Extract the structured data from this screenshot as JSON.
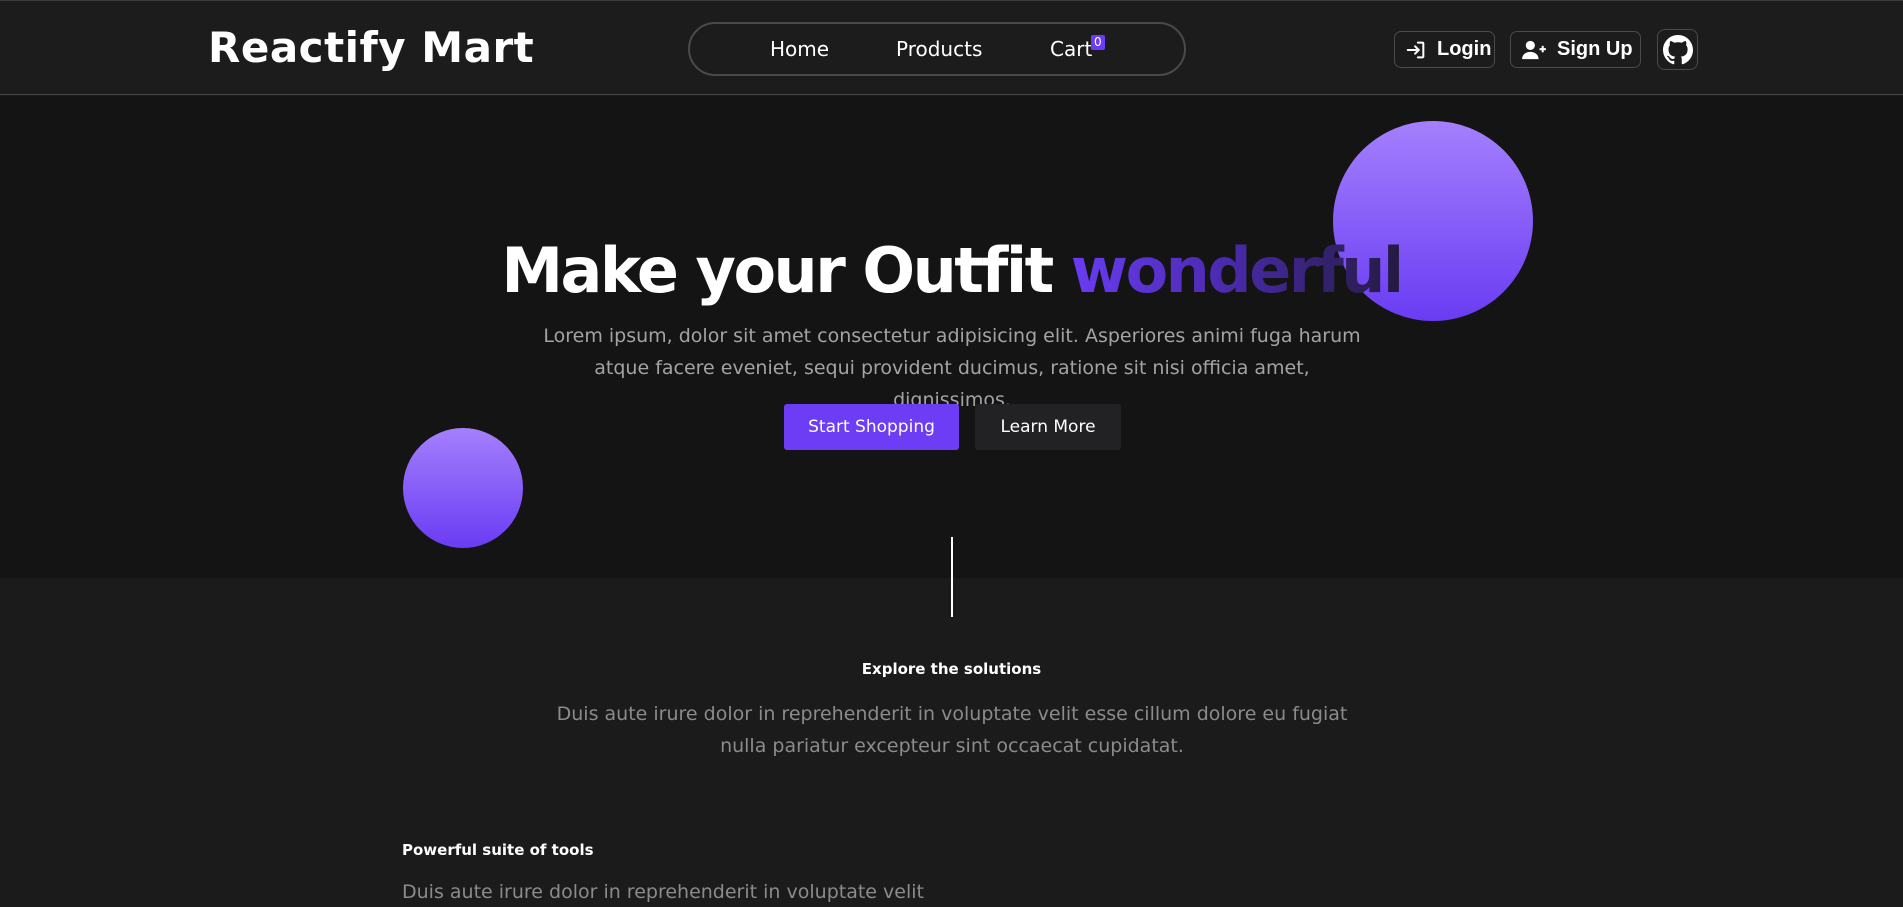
{
  "navbar": {
    "brand": "Reactify Mart",
    "links": [
      {
        "label": "Home"
      },
      {
        "label": "Products"
      },
      {
        "label": "Cart"
      }
    ],
    "cart_count": "0",
    "login_label": "Login",
    "signup_label": "Sign Up",
    "icons": {
      "login": "login-icon",
      "signup": "user-plus-icon",
      "github": "github-icon"
    }
  },
  "hero": {
    "title_main": "Make your Outfit ",
    "title_accent": "wonderful",
    "description": "Lorem ipsum, dolor sit amet consectetur adipisicing elit. Asperiores animi fuga harum atque facere eveniet, sequi provident ducimus, ratione sit nisi officia amet, dignissimos.",
    "primary_button": "Start Shopping",
    "secondary_button": "Learn More"
  },
  "solutions": {
    "heading": "Explore the solutions",
    "description": "Duis aute irure dolor in reprehenderit in voluptate velit esse cillum dolore eu fugiat nulla pariatur excepteur sint occaecat cupidatat."
  },
  "tools": {
    "heading": "Powerful suite of tools",
    "description": "Duis aute irure dolor in reprehenderit in voluptate velit"
  },
  "colors": {
    "accent": "#6d3cf5",
    "background": "#141414",
    "navbar": "#1c1c1c",
    "muted_text": "#a3a3a3"
  }
}
